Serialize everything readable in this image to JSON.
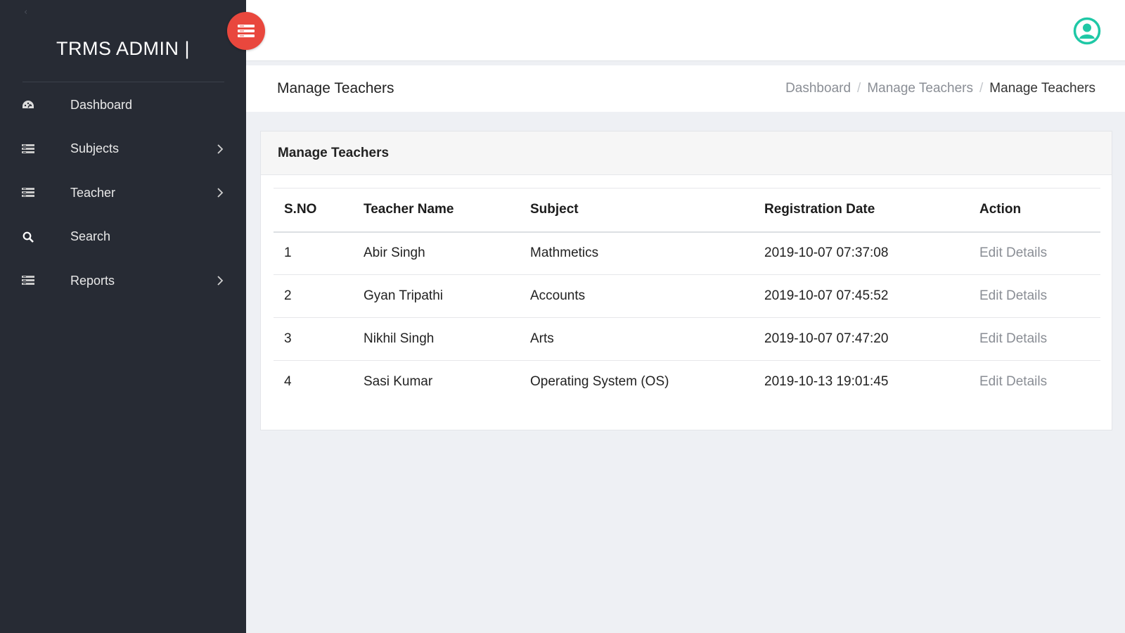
{
  "app": {
    "brand": "TRMS ADMIN |"
  },
  "colors": {
    "sidebar": "#272b34",
    "accent": "#e9473d",
    "user_icon": "#1fc8a6"
  },
  "sidebar": {
    "items": [
      {
        "label": "Dashboard",
        "icon": "dashboard-gauge-icon",
        "has_submenu": false
      },
      {
        "label": "Subjects",
        "icon": "list-icon",
        "has_submenu": true
      },
      {
        "label": "Teacher",
        "icon": "list-icon",
        "has_submenu": true
      },
      {
        "label": "Search",
        "icon": "search-icon",
        "has_submenu": false
      },
      {
        "label": "Reports",
        "icon": "list-icon",
        "has_submenu": true
      }
    ]
  },
  "header": {
    "page_title": "Manage Teachers",
    "breadcrumb": [
      "Dashboard",
      "Manage Teachers",
      "Manage Teachers"
    ]
  },
  "card": {
    "title": "Manage Teachers",
    "columns": [
      "S.NO",
      "Teacher Name",
      "Subject",
      "Registration Date",
      "Action"
    ],
    "rows": [
      {
        "sno": "1",
        "name": "Abir Singh",
        "subject": "Mathmetics",
        "date": "2019-10-07 07:37:08",
        "action": "Edit Details"
      },
      {
        "sno": "2",
        "name": "Gyan Tripathi",
        "subject": "Accounts",
        "date": "2019-10-07 07:45:52",
        "action": "Edit Details"
      },
      {
        "sno": "3",
        "name": "Nikhil Singh",
        "subject": "Arts",
        "date": "2019-10-07 07:47:20",
        "action": "Edit Details"
      },
      {
        "sno": "4",
        "name": "Sasi Kumar",
        "subject": "Operating System (OS)",
        "date": "2019-10-13 19:01:45",
        "action": "Edit Details"
      }
    ]
  }
}
